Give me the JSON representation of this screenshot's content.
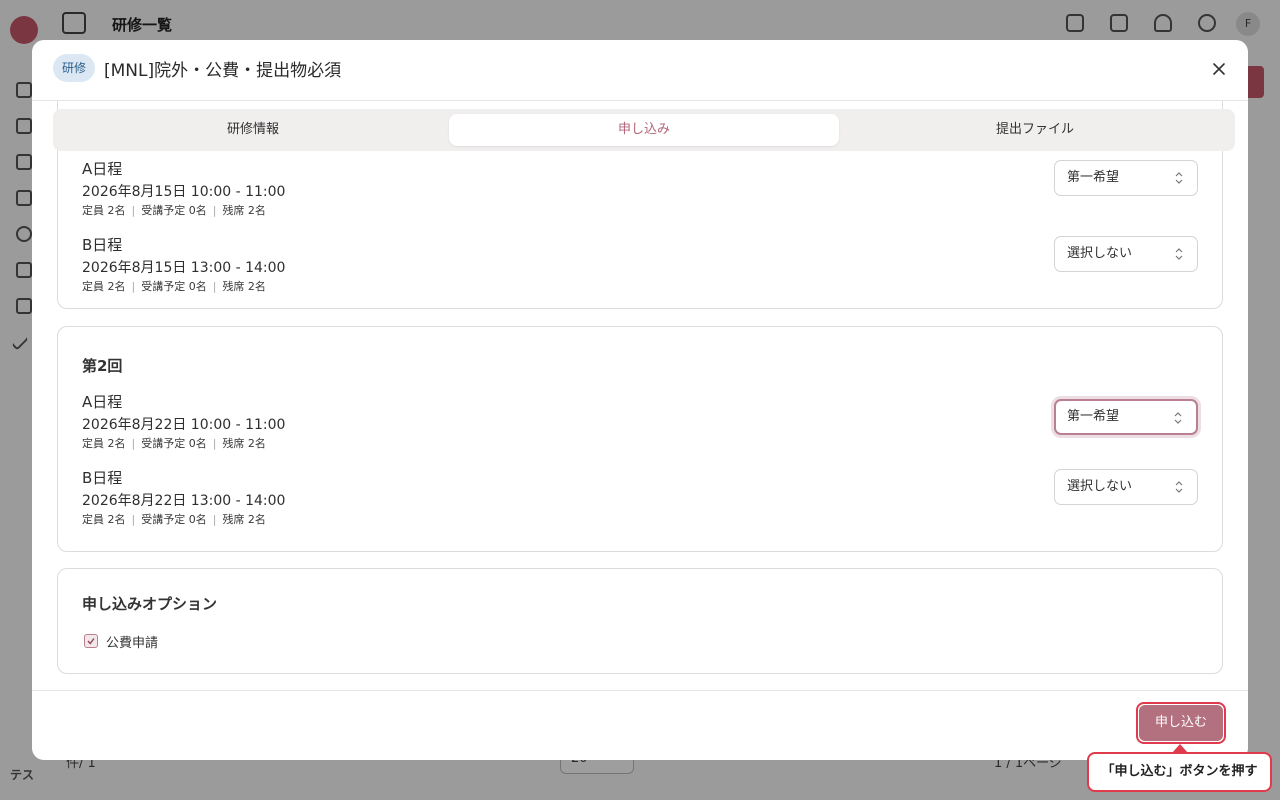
{
  "background": {
    "title": "研修一覧",
    "user_initial": "F",
    "sidebar_user": "テス",
    "footer_left": "件/ 1",
    "footer_select": "20",
    "footer_right": "1 / 1ページ"
  },
  "modal": {
    "badge": "研修",
    "title": "[MNL]院外・公費・提出物必須",
    "tabs": [
      {
        "label": "研修情報",
        "active": false
      },
      {
        "label": "申し込み",
        "active": true
      },
      {
        "label": "提出ファイル",
        "active": false
      }
    ],
    "sessions": [
      {
        "heading": "",
        "slots": [
          {
            "name": "A日程",
            "datetime": "2026年8月15日 10:00 - 11:00",
            "capacity": "定員 2名",
            "planned": "受講予定 0名",
            "remaining": "残席 2名",
            "choice": "第一希望"
          },
          {
            "name": "B日程",
            "datetime": "2026年8月15日 13:00 - 14:00",
            "capacity": "定員 2名",
            "planned": "受講予定 0名",
            "remaining": "残席 2名",
            "choice": "選択しない"
          }
        ]
      },
      {
        "heading": "第2回",
        "slots": [
          {
            "name": "A日程",
            "datetime": "2026年8月22日 10:00 - 11:00",
            "capacity": "定員 2名",
            "planned": "受講予定 0名",
            "remaining": "残席 2名",
            "choice": "第一希望"
          },
          {
            "name": "B日程",
            "datetime": "2026年8月22日 13:00 - 14:00",
            "capacity": "定員 2名",
            "planned": "受講予定 0名",
            "remaining": "残席 2名",
            "choice": "選択しない"
          }
        ]
      }
    ],
    "options": {
      "heading": "申し込みオプション",
      "public_funding": {
        "label": "公費申請",
        "checked": true
      }
    },
    "submit_label": "申し込む"
  },
  "tooltip": "「申し込む」ボタンを押す",
  "colors": {
    "accent": "#b3707f",
    "highlight": "#e03a4d",
    "badge_bg": "#dbe8f3"
  }
}
